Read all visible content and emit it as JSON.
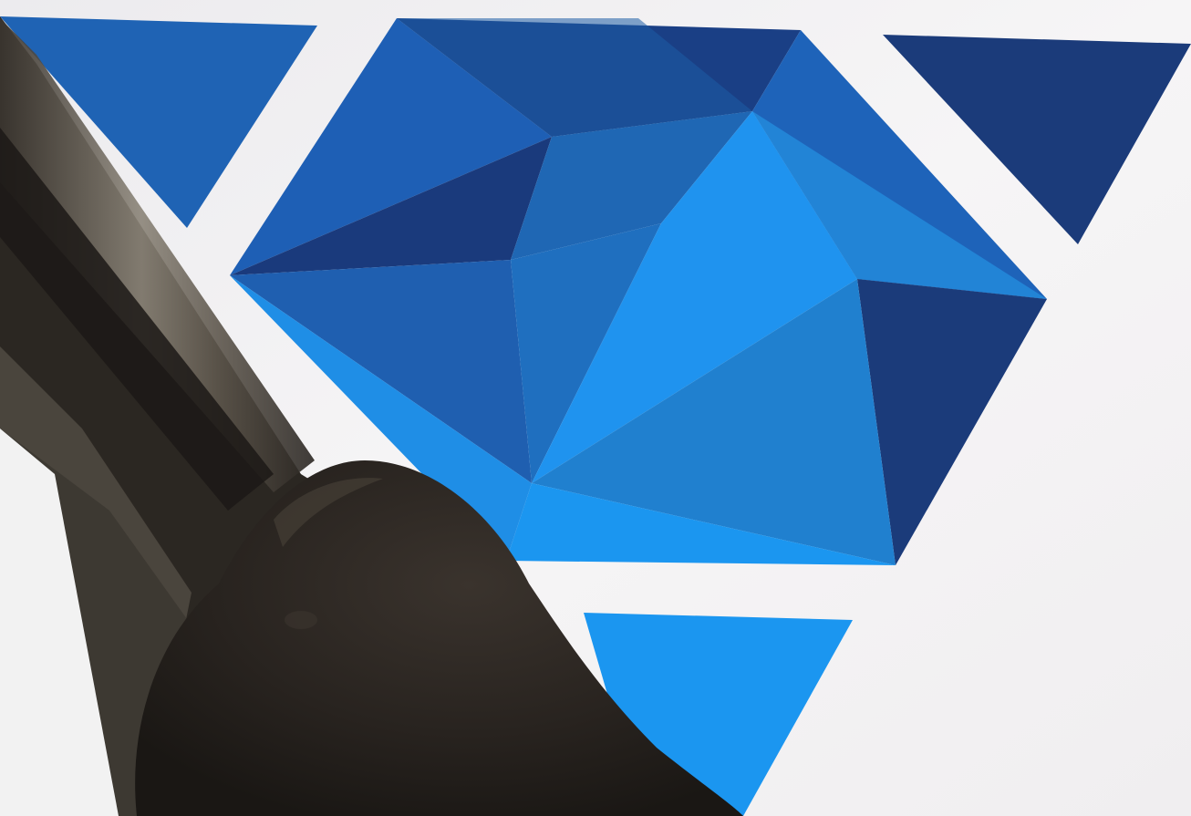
{
  "scene": {
    "description_kind": "photo-of-screen",
    "screen_color": "#f3f2f4",
    "palette": {
      "navy": "#1b3a78",
      "dark_blue": "#1c4d9c",
      "medium_blue": "#1e62b6",
      "mid_blue": "#2271c5",
      "bright_blue": "#1f8ee6",
      "sky_blue": "#1b96f0",
      "device_edge": "#6a6458",
      "device_shadow": "#2d2924",
      "finger": "#2a2521"
    }
  },
  "shapes": [
    {
      "name": "top-left-triangle",
      "color": "medium_blue"
    },
    {
      "name": "top-right-triangle",
      "color": "navy"
    },
    {
      "name": "bottom-triangle",
      "color": "sky_blue"
    },
    {
      "name": "hexagon-cluster",
      "facets": 14
    }
  ]
}
